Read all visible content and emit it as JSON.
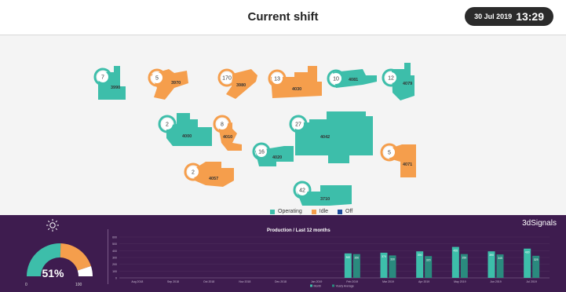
{
  "header": {
    "title": "Current shift",
    "date": "30 Jul 2019",
    "time": "13:29"
  },
  "colors": {
    "operating": "#3dbeaa",
    "idle": "#f59e4c",
    "off": "#1d4c9c",
    "bottom_bg": "#3e1c4f"
  },
  "machines": [
    {
      "id": "3990",
      "count": "7",
      "status": "operating"
    },
    {
      "id": "3970",
      "count": "5",
      "status": "idle"
    },
    {
      "id": "3980",
      "count": "170",
      "status": "idle"
    },
    {
      "id": "4030",
      "count": "13",
      "status": "idle"
    },
    {
      "id": "4081",
      "count": "10",
      "status": "operating"
    },
    {
      "id": "4079",
      "count": "12",
      "status": "operating"
    },
    {
      "id": "4000",
      "count": "2",
      "status": "operating"
    },
    {
      "id": "4010",
      "count": "8",
      "status": "idle"
    },
    {
      "id": "4042",
      "count": "27",
      "status": "operating"
    },
    {
      "id": "4020",
      "count": "16",
      "status": "operating"
    },
    {
      "id": "4071",
      "count": "5",
      "status": "idle"
    },
    {
      "id": "4057",
      "count": "2",
      "status": "idle"
    },
    {
      "id": "3710",
      "count": "42",
      "status": "operating"
    }
  ],
  "legend": {
    "operating": "Operating",
    "idle": "Idle",
    "off": "Off"
  },
  "gauge": {
    "percent": "51%",
    "value": 0.51,
    "min": "0",
    "max": "100",
    "icon": "sun-icon"
  },
  "brand": "3dSignals",
  "chart_data": {
    "type": "bar",
    "title": "Production / Last 12 months",
    "categories": [
      "Aug 2018",
      "Sep 2018",
      "Oct 2018",
      "Nov 2018",
      "Dec 2018",
      "Jan 2019",
      "Feb 2019",
      "Mar 2019",
      "Apr 2019",
      "May 2019",
      "Jun 2019",
      "Jul 2019"
    ],
    "series": [
      {
        "name": "Month",
        "values": [
          0,
          0,
          0,
          0,
          0,
          0,
          360,
          370,
          390,
          455,
          390,
          430
        ]
      },
      {
        "name": "Yearly Average",
        "values": [
          0,
          0,
          0,
          0,
          0,
          0,
          350,
          330,
          320,
          350,
          345,
          325
        ]
      }
    ],
    "data_labels": {
      "Month": [
        "",
        "",
        "",
        "",
        "",
        "",
        "360",
        "370",
        "390",
        "455",
        "390",
        "430"
      ],
      "Yearly Average": [
        "",
        "",
        "",
        "",
        "",
        "",
        "350",
        "330",
        "320",
        "350",
        "345",
        "325"
      ]
    },
    "ylim": [
      0,
      600
    ],
    "yticks": [
      "600",
      "500",
      "400",
      "300",
      "200",
      "100",
      "0"
    ],
    "legend": [
      "Month",
      "Yearly Average"
    ]
  }
}
